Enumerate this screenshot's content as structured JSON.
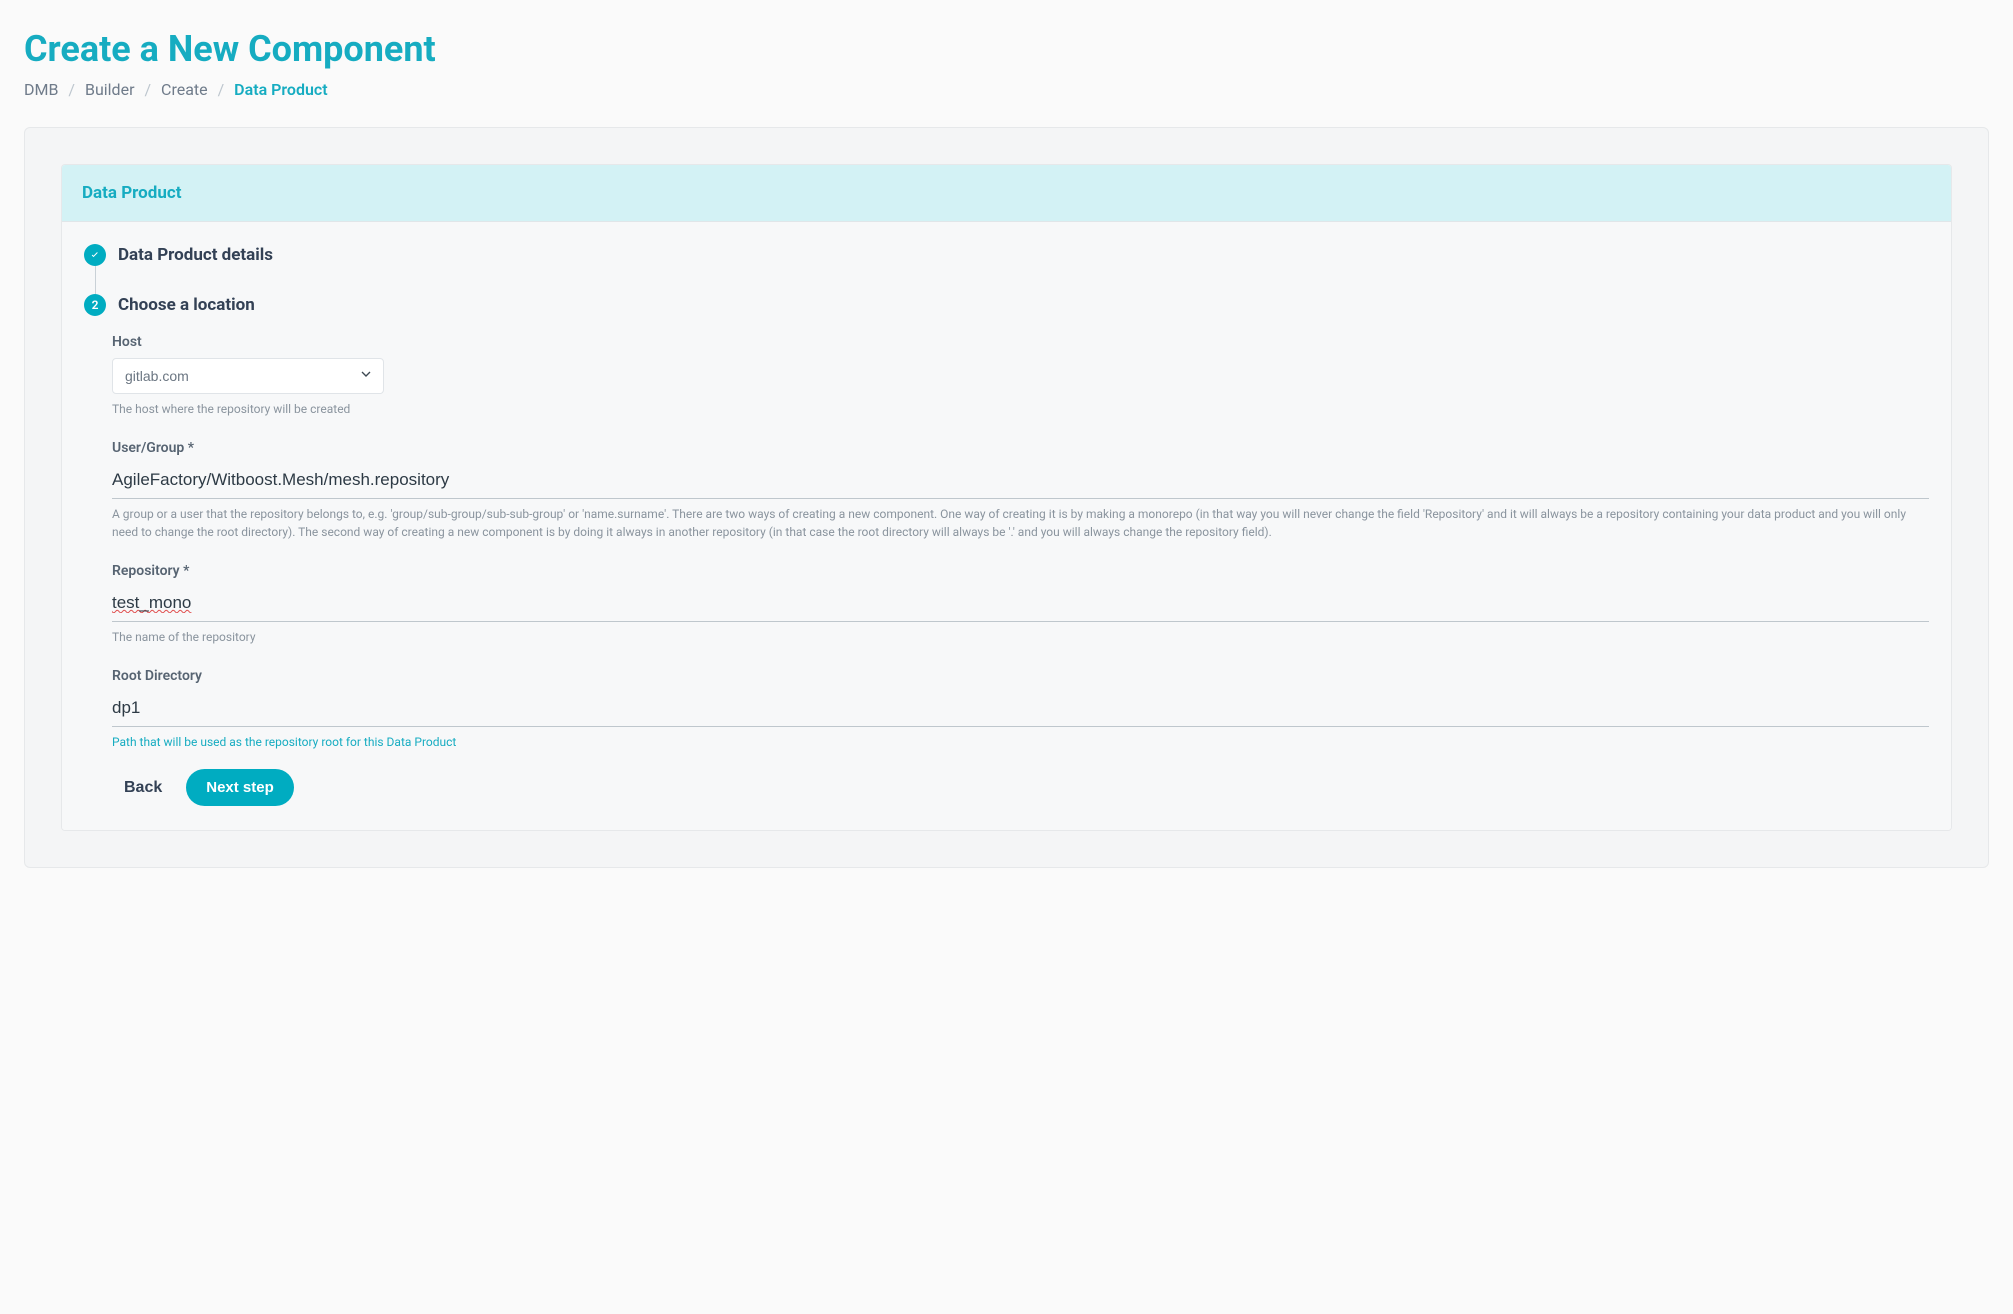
{
  "header": {
    "title": "Create a New Component"
  },
  "breadcrumb": {
    "items": [
      "DMB",
      "Builder",
      "Create",
      "Data Product"
    ]
  },
  "panel": {
    "title": "Data Product"
  },
  "steps": [
    {
      "label": "Data Product details",
      "state": "done"
    },
    {
      "label": "Choose a location",
      "state": "current",
      "number": "2"
    }
  ],
  "form": {
    "host": {
      "label": "Host",
      "value": "gitlab.com",
      "hint": "The host where the repository will be created"
    },
    "userGroup": {
      "label": "User/Group *",
      "value": "AgileFactory/Witboost.Mesh/mesh.repository",
      "hint": "A group or a user that the repository belongs to, e.g. 'group/sub-group/sub-sub-group' or 'name.surname'. There are two ways of creating a new component. One way of creating it is by making a monorepo (in that way you will never change the field 'Repository' and it will always be a repository containing your data product and you will only need to change the root directory). The second way of creating a new component is by doing it always in another repository (in that case the root directory will always be '.' and you will always change the repository field)."
    },
    "repository": {
      "label": "Repository *",
      "value": "test_mono",
      "hint": "The name of the repository"
    },
    "rootDir": {
      "label": "Root Directory",
      "value": "dp1",
      "hint": "Path that will be used as the repository root for this Data Product"
    }
  },
  "actions": {
    "back": "Back",
    "next": "Next step"
  }
}
